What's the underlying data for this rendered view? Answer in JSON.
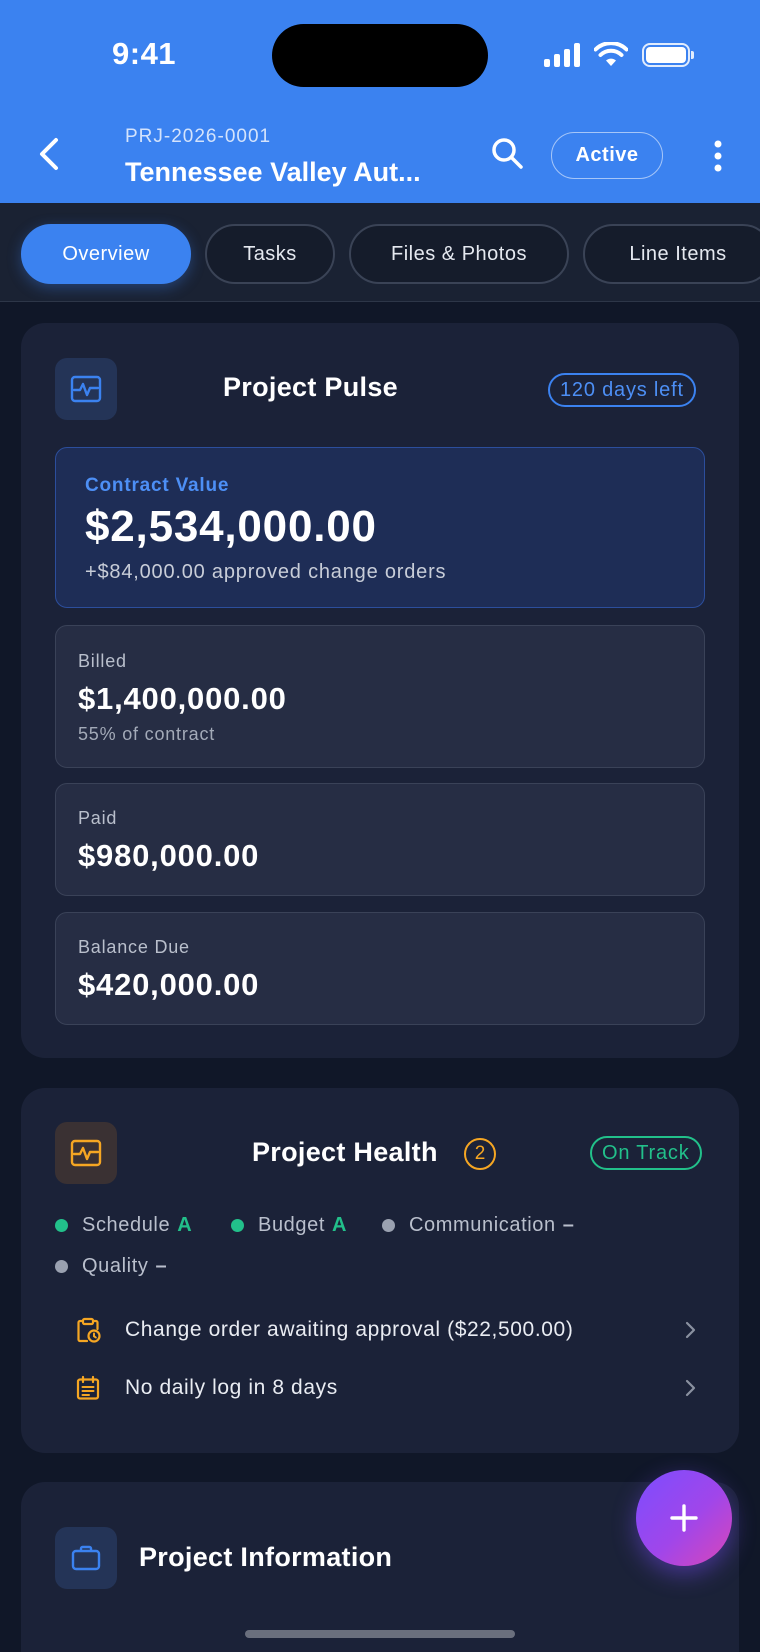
{
  "status_bar": {
    "time": "9:41"
  },
  "header": {
    "project_id": "PRJ-2026-0001",
    "project_name": "Tennessee Valley Aut...",
    "status_label": "Active"
  },
  "tabs": [
    {
      "label": "Overview",
      "active": true
    },
    {
      "label": "Tasks",
      "active": false
    },
    {
      "label": "Files & Photos",
      "active": false
    },
    {
      "label": "Line Items",
      "active": false
    }
  ],
  "pulse": {
    "title": "Project Pulse",
    "days_left": "120 days left",
    "contract": {
      "label": "Contract Value",
      "value": "$2,534,000.00",
      "sub": "+$84,000.00 approved change orders"
    },
    "billed": {
      "label": "Billed",
      "value": "$1,400,000.00",
      "sub": "55% of contract"
    },
    "paid": {
      "label": "Paid",
      "value": "$980,000.00"
    },
    "balance": {
      "label": "Balance Due",
      "value": "$420,000.00"
    }
  },
  "health": {
    "title": "Project Health",
    "count": "2",
    "status": "On Track",
    "metrics": [
      {
        "label": "Schedule",
        "grade": "A",
        "color": "#22c08a"
      },
      {
        "label": "Budget",
        "grade": "A",
        "color": "#22c08a"
      },
      {
        "label": "Communication",
        "grade": "–",
        "color": "#9aa1b0"
      },
      {
        "label": "Quality",
        "grade": "–",
        "color": "#9aa1b0"
      }
    ],
    "alerts": [
      {
        "text": "Change order awaiting approval ($22,500.00)",
        "icon": "clipboard-clock-icon"
      },
      {
        "text": "No daily log in 8 days",
        "icon": "calendar-list-icon"
      }
    ]
  },
  "info": {
    "title": "Project Information"
  },
  "colors": {
    "brand": "#3b82f0",
    "warning": "#f5a623",
    "success": "#22c08a"
  }
}
